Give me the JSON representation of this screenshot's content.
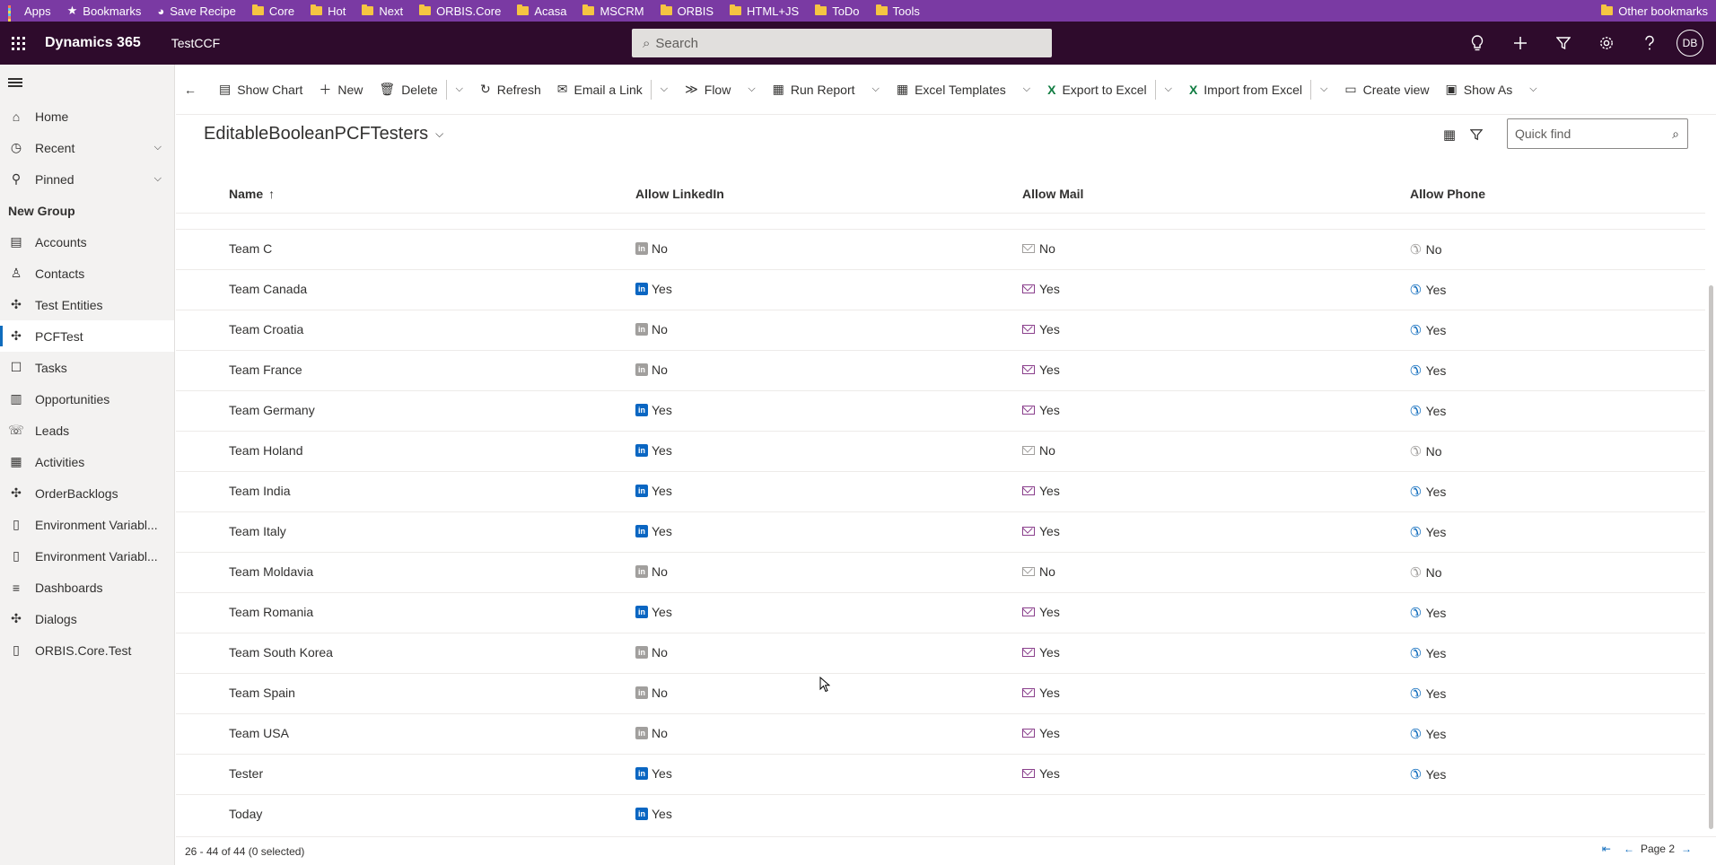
{
  "bookmarks_bar": {
    "items": [
      {
        "label": "Apps",
        "icon": "apps-grid-icon"
      },
      {
        "label": "Bookmarks",
        "icon": "star-icon"
      },
      {
        "label": "Save Recipe",
        "icon": "recipe-icon"
      },
      {
        "label": "Core",
        "icon": "folder-icon"
      },
      {
        "label": "Hot",
        "icon": "folder-icon"
      },
      {
        "label": "Next",
        "icon": "folder-icon"
      },
      {
        "label": "ORBIS.Core",
        "icon": "folder-icon"
      },
      {
        "label": "Acasa",
        "icon": "folder-icon"
      },
      {
        "label": "MSCRM",
        "icon": "folder-icon"
      },
      {
        "label": "ORBIS",
        "icon": "folder-icon"
      },
      {
        "label": "HTML+JS",
        "icon": "folder-icon"
      },
      {
        "label": "ToDo",
        "icon": "folder-icon"
      },
      {
        "label": "Tools",
        "icon": "folder-icon"
      }
    ],
    "other": "Other bookmarks"
  },
  "appbar": {
    "brand": "Dynamics 365",
    "app_name": "TestCCF",
    "search_placeholder": "Search",
    "avatar_initials": "DB"
  },
  "sidebar": {
    "top_items": [
      {
        "label": "Home",
        "icon": "home-icon"
      },
      {
        "label": "Recent",
        "icon": "clock-icon",
        "expandable": true
      },
      {
        "label": "Pinned",
        "icon": "pin-icon",
        "expandable": true
      }
    ],
    "group_label": "New Group",
    "group_items": [
      {
        "label": "Accounts",
        "icon": "account-icon"
      },
      {
        "label": "Contacts",
        "icon": "contact-icon"
      },
      {
        "label": "Test Entities",
        "icon": "puzzle-icon"
      },
      {
        "label": "PCFTest",
        "icon": "puzzle-icon",
        "active": true
      },
      {
        "label": "Tasks",
        "icon": "task-icon"
      },
      {
        "label": "Opportunities",
        "icon": "opportunity-icon"
      },
      {
        "label": "Leads",
        "icon": "lead-icon"
      },
      {
        "label": "Activities",
        "icon": "activity-icon"
      },
      {
        "label": "OrderBacklogs",
        "icon": "puzzle-icon"
      },
      {
        "label": "Environment Variabl...",
        "icon": "document-icon"
      },
      {
        "label": "Environment Variabl...",
        "icon": "document-icon"
      },
      {
        "label": "Dashboards",
        "icon": "dashboard-icon"
      },
      {
        "label": "Dialogs",
        "icon": "puzzle-icon"
      },
      {
        "label": "ORBIS.Core.Test",
        "icon": "document-icon"
      }
    ]
  },
  "commands": {
    "show_chart": "Show Chart",
    "new": "New",
    "delete": "Delete",
    "refresh": "Refresh",
    "email_link": "Email a Link",
    "flow": "Flow",
    "run_report": "Run Report",
    "excel_templates": "Excel Templates",
    "export_excel": "Export to Excel",
    "import_excel": "Import from Excel",
    "create_view": "Create view",
    "show_as": "Show As"
  },
  "view": {
    "title": "EditableBooleanPCFTesters",
    "quick_find_placeholder": "Quick find"
  },
  "grid": {
    "columns": {
      "name": "Name",
      "linkedin": "Allow LinkedIn",
      "mail": "Allow Mail",
      "phone": "Allow Phone"
    },
    "rows": [
      {
        "name": "Team C",
        "linkedin": "No",
        "mail": "No",
        "phone": "No"
      },
      {
        "name": "Team Canada",
        "linkedin": "Yes",
        "mail": "Yes",
        "phone": "Yes"
      },
      {
        "name": "Team Croatia",
        "linkedin": "No",
        "mail": "Yes",
        "phone": "Yes"
      },
      {
        "name": "Team France",
        "linkedin": "No",
        "mail": "Yes",
        "phone": "Yes"
      },
      {
        "name": "Team Germany",
        "linkedin": "Yes",
        "mail": "Yes",
        "phone": "Yes"
      },
      {
        "name": "Team Holand",
        "linkedin": "Yes",
        "mail": "No",
        "phone": "No"
      },
      {
        "name": "Team India",
        "linkedin": "Yes",
        "mail": "Yes",
        "phone": "Yes"
      },
      {
        "name": "Team Italy",
        "linkedin": "Yes",
        "mail": "Yes",
        "phone": "Yes"
      },
      {
        "name": "Team Moldavia",
        "linkedin": "No",
        "mail": "No",
        "phone": "No"
      },
      {
        "name": "Team Romania",
        "linkedin": "Yes",
        "mail": "Yes",
        "phone": "Yes"
      },
      {
        "name": "Team South Korea",
        "linkedin": "No",
        "mail": "Yes",
        "phone": "Yes"
      },
      {
        "name": "Team Spain",
        "linkedin": "No",
        "mail": "Yes",
        "phone": "Yes"
      },
      {
        "name": "Team USA",
        "linkedin": "No",
        "mail": "Yes",
        "phone": "Yes"
      },
      {
        "name": "Tester",
        "linkedin": "Yes",
        "mail": "Yes",
        "phone": "Yes"
      },
      {
        "name": "Today",
        "linkedin": "Yes",
        "mail": "",
        "phone": ""
      }
    ]
  },
  "footer": {
    "count_text": "26 - 44 of 44 (0 selected)",
    "page_label": "Page 2"
  }
}
